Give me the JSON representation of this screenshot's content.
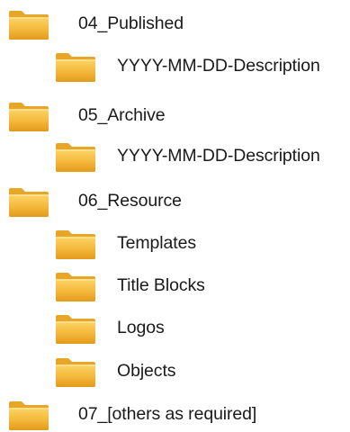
{
  "tree": {
    "items": [
      {
        "label": "04_Published",
        "level": 0,
        "icon": "folder-icon"
      },
      {
        "label": "YYYY-MM-DD-Description",
        "level": 1,
        "icon": "folder-icon"
      },
      {
        "label": "05_Archive",
        "level": 0,
        "icon": "folder-icon"
      },
      {
        "label": "YYYY-MM-DD-Description",
        "level": 1,
        "icon": "folder-icon"
      },
      {
        "label": "06_Resource",
        "level": 0,
        "icon": "folder-icon"
      },
      {
        "label": "Templates",
        "level": 1,
        "icon": "folder-icon"
      },
      {
        "label": "Title Blocks",
        "level": 1,
        "icon": "folder-icon"
      },
      {
        "label": "Logos",
        "level": 1,
        "icon": "folder-icon"
      },
      {
        "label": "Objects",
        "level": 1,
        "icon": "folder-icon"
      },
      {
        "label": "07_[others as required]",
        "level": 0,
        "icon": "folder-icon"
      }
    ]
  },
  "colors": {
    "folder_light": "#fcd468",
    "folder_mid": "#f4b83a",
    "folder_dark": "#e29a1c",
    "folder_tab": "#e8a628",
    "text": "#1a1a1a"
  }
}
